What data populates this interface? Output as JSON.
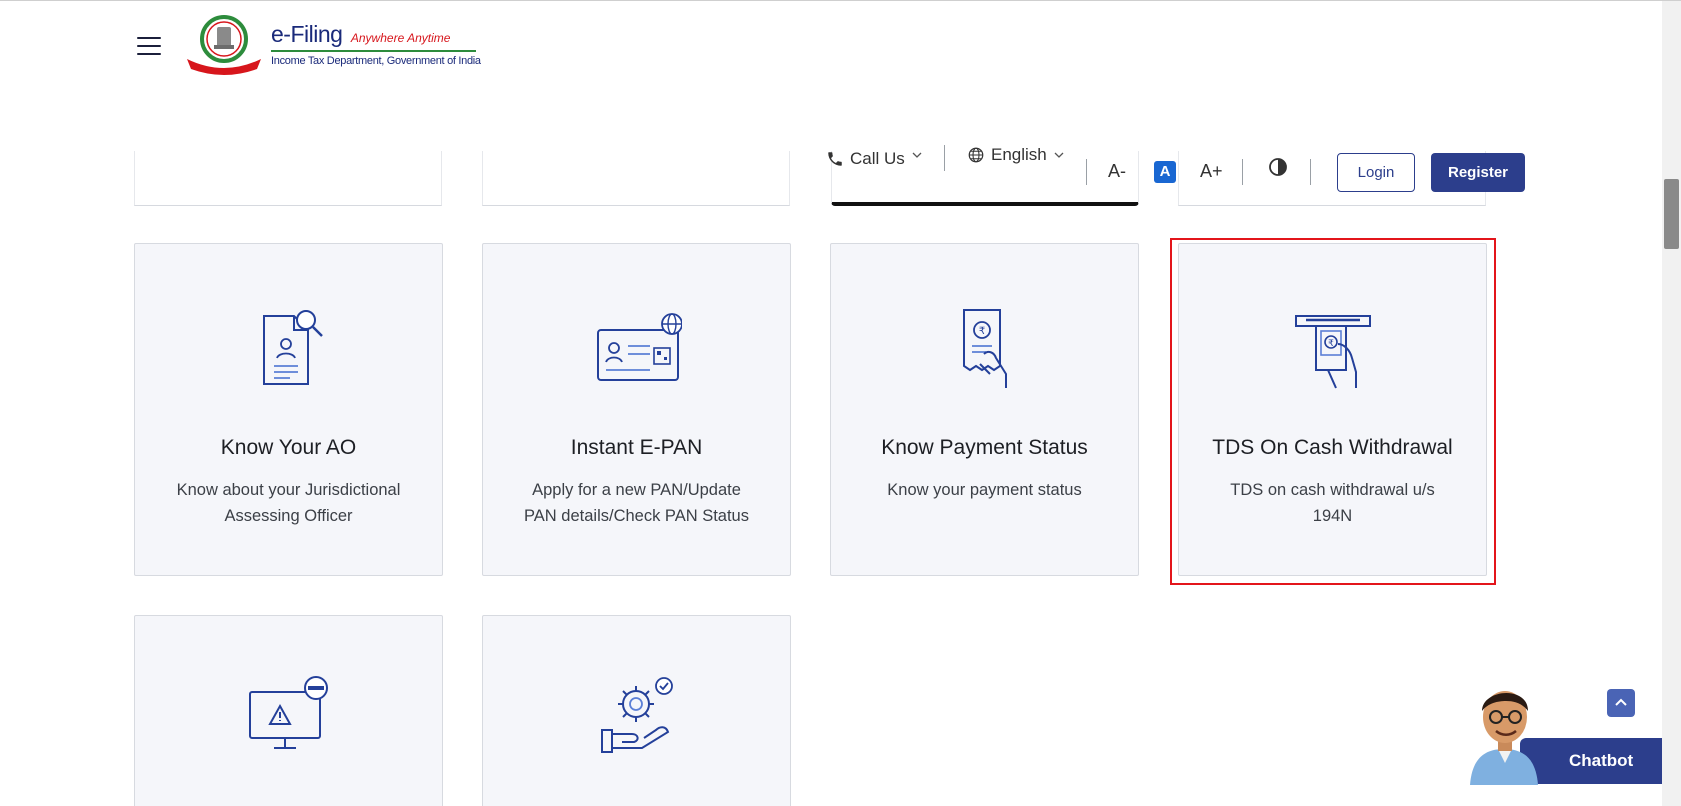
{
  "header": {
    "brand_main": "e-Filing",
    "brand_tag": "Anywhere Anytime",
    "brand_sub": "Income Tax Department, Government of India"
  },
  "toolbar": {
    "call_us": "Call Us",
    "language": "English",
    "font_decrease": "A-",
    "font_normal": "A",
    "font_increase": "A+",
    "login_label": "Login",
    "register_label": "Register"
  },
  "cards": [
    {
      "title": "Know Your AO",
      "desc": "Know about your Jurisdictional Assessing Officer",
      "icon": "document-search-icon"
    },
    {
      "title": "Instant E-PAN",
      "desc": "Apply for a new PAN/Update PAN details/Check PAN Status",
      "icon": "pan-card-icon"
    },
    {
      "title": "Know Payment Status",
      "desc": "Know your payment status",
      "icon": "payment-receipt-icon"
    },
    {
      "title": "TDS On Cash Withdrawal",
      "desc": "TDS on cash withdrawal u/s 194N",
      "icon": "atm-withdrawal-icon"
    }
  ],
  "bottom_cards": [
    {
      "icon": "monitor-warning-icon"
    },
    {
      "icon": "gear-hand-icon"
    }
  ],
  "chatbot": {
    "label": "Chatbot"
  },
  "colors": {
    "primary": "#2c3e8c",
    "highlight": "#e3151b",
    "card_bg": "#f5f6fa"
  }
}
